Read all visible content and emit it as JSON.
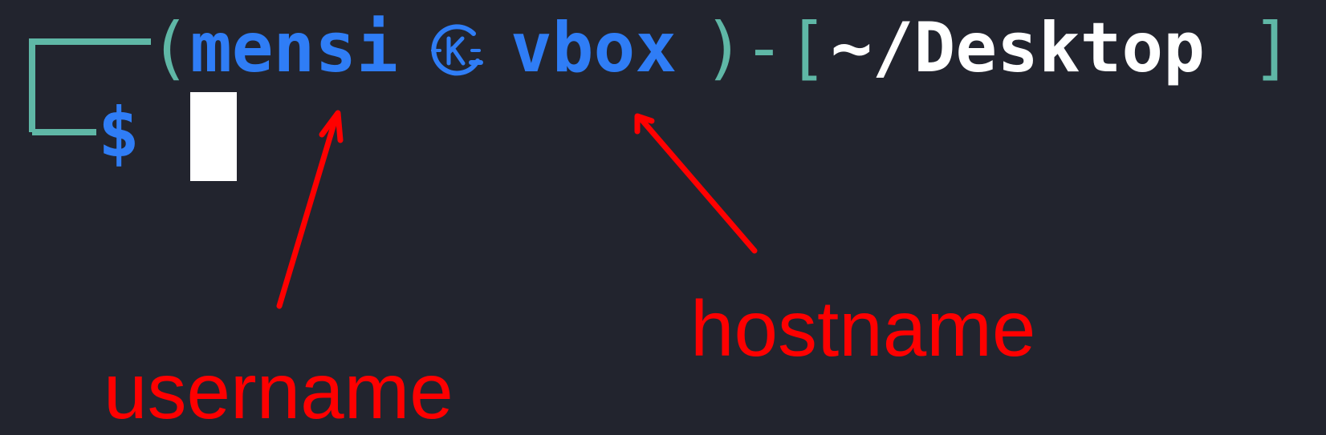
{
  "terminal": {
    "background": "#22242e",
    "open_paren": "(",
    "username": "mensi",
    "host_separator_icon": "kali-logo-icon",
    "hostname": "vbox",
    "close_paren": ")",
    "dash": "-",
    "open_bracket": "[",
    "cwd": "~/Desktop",
    "close_bracket": "]",
    "prompt_symbol": "$",
    "colors": {
      "user_host": "#2f7df6",
      "frame": "#5fb7a6",
      "path": "#ffffff",
      "cursor": "#ffffff"
    }
  },
  "annotations": {
    "username_label": "username",
    "hostname_label": "hostname",
    "color": "#ff0000"
  }
}
